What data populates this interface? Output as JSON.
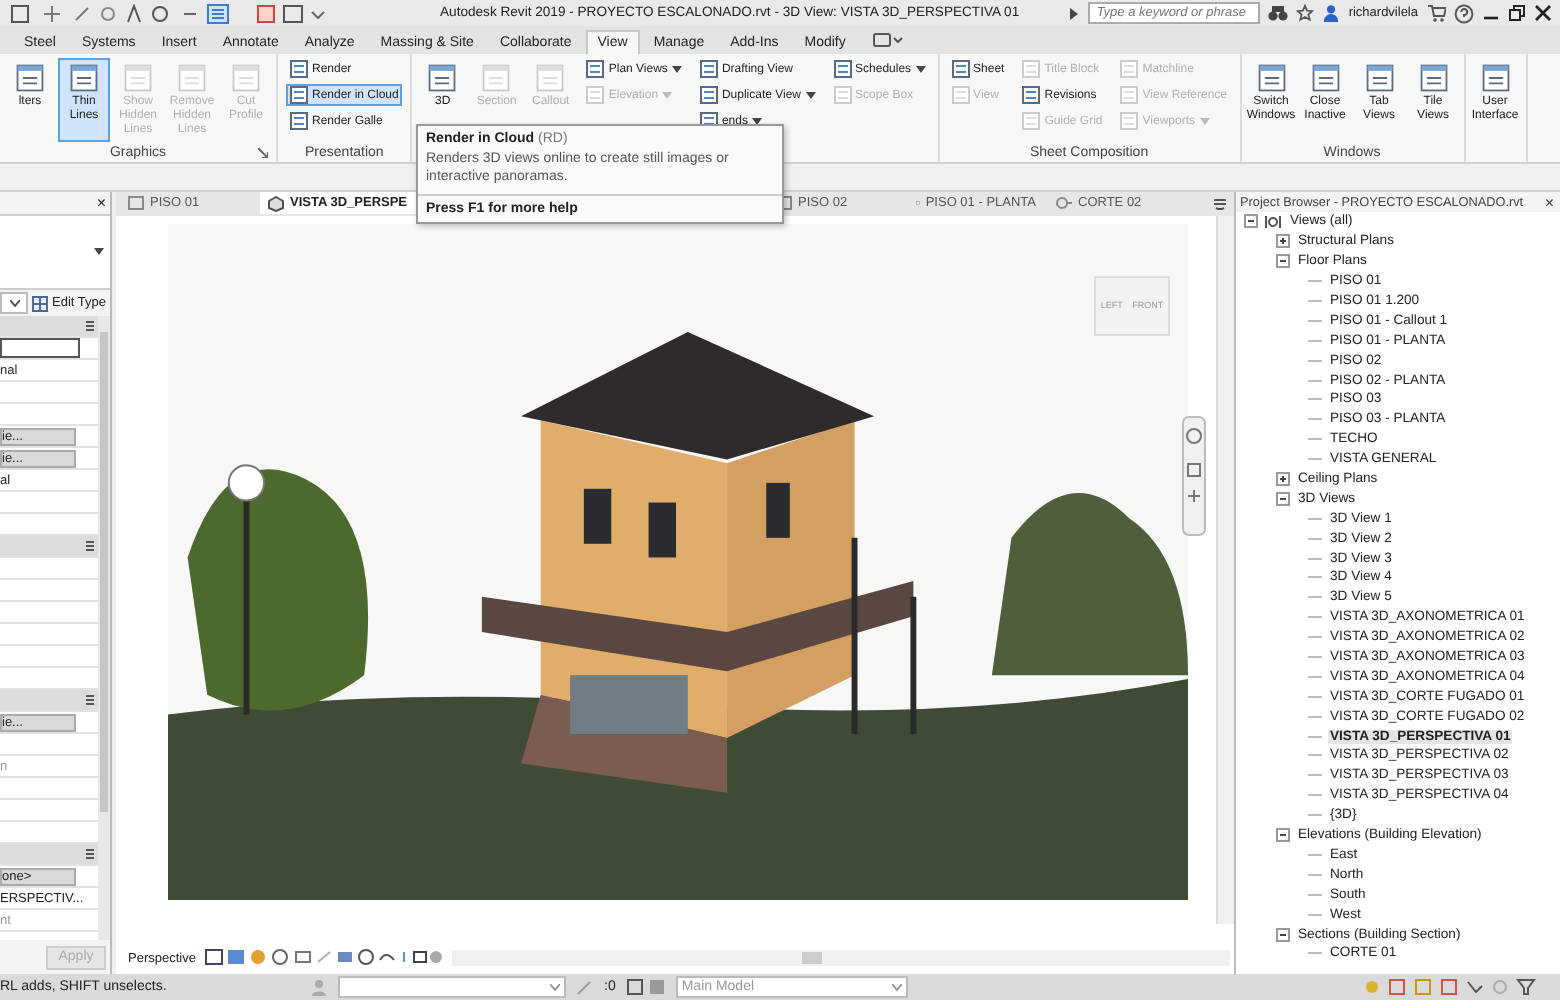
{
  "title_bar": {
    "title": "Autodesk Revit 2019 - PROYECTO ESCALONADO.rvt - 3D View: VISTA 3D_PERSPECTIVA 01",
    "search": {
      "placeholder": "Type a keyword or phrase"
    },
    "user": "richardvilela"
  },
  "ribbon_tabs": [
    {
      "label": "Steel",
      "selected": false
    },
    {
      "label": "Systems",
      "selected": false
    },
    {
      "label": "Insert",
      "selected": false
    },
    {
      "label": "Annotate",
      "selected": false
    },
    {
      "label": "Analyze",
      "selected": false
    },
    {
      "label": "Massing & Site",
      "selected": false
    },
    {
      "label": "Collaborate",
      "selected": false
    },
    {
      "label": "View",
      "selected": true
    },
    {
      "label": "Manage",
      "selected": false
    },
    {
      "label": "Add-Ins",
      "selected": false
    },
    {
      "label": "Modify",
      "selected": false
    }
  ],
  "ribbon_panels": [
    {
      "title": "Graphics",
      "dialog_launcher": true,
      "columns": [
        {
          "kind": "large",
          "items": [
            {
              "label": "lters",
              "disabled": false,
              "selected": false
            }
          ]
        },
        {
          "kind": "large",
          "items": [
            {
              "label": "Thin Lines",
              "disabled": false,
              "selected": true
            }
          ]
        },
        {
          "kind": "large",
          "items": [
            {
              "label": "Show Hidden Lines",
              "disabled": true,
              "selected": false
            }
          ]
        },
        {
          "kind": "large",
          "items": [
            {
              "label": "Remove Hidden Lines",
              "disabled": true,
              "selected": false
            }
          ]
        },
        {
          "kind": "large",
          "items": [
            {
              "label": "Cut Profile",
              "disabled": true,
              "selected": false
            }
          ]
        }
      ]
    },
    {
      "title": "Presentation",
      "columns": [
        {
          "kind": "stack",
          "items": [
            {
              "label": "Render",
              "disabled": false,
              "selected": false,
              "dropdown": false
            },
            {
              "label": "Render  in Cloud",
              "disabled": false,
              "selected": true,
              "dropdown": false
            },
            {
              "label": "Render  Galle",
              "disabled": false,
              "selected": false,
              "dropdown": false
            }
          ]
        }
      ]
    },
    {
      "columns": [
        {
          "kind": "large",
          "items": [
            {
              "label": "3D",
              "disabled": false,
              "selected": false
            }
          ]
        },
        {
          "kind": "large",
          "items": [
            {
              "label": "Section",
              "disabled": true,
              "selected": false
            }
          ]
        },
        {
          "kind": "large",
          "items": [
            {
              "label": "Callout",
              "disabled": true,
              "selected": false
            }
          ]
        },
        {
          "kind": "stack",
          "items": [
            {
              "label": "Plan Views",
              "disabled": false,
              "selected": false,
              "dropdown": true
            },
            {
              "label": "Elevation",
              "disabled": true,
              "selected": false,
              "dropdown": true
            }
          ]
        },
        {
          "kind": "stack",
          "items": [
            {
              "label": "Drafting View",
              "disabled": false,
              "selected": false,
              "dropdown": false
            },
            {
              "label": "Duplicate View",
              "disabled": false,
              "selected": false,
              "dropdown": true
            },
            {
              "label": "ends",
              "disabled": false,
              "selected": false,
              "dropdown": true
            }
          ]
        },
        {
          "kind": "stack",
          "items": [
            {
              "label": "Schedules",
              "disabled": false,
              "selected": false,
              "dropdown": true
            },
            {
              "label": "Scope Box",
              "disabled": true,
              "selected": false,
              "dropdown": false
            }
          ]
        }
      ]
    },
    {
      "title": "Sheet Composition",
      "columns": [
        {
          "kind": "stack",
          "items": [
            {
              "label": "Sheet",
              "disabled": false,
              "selected": false,
              "dropdown": false
            },
            {
              "label": "View",
              "disabled": true,
              "selected": false,
              "dropdown": false
            }
          ]
        },
        {
          "kind": "stack",
          "items": [
            {
              "label": "Title Block",
              "disabled": true,
              "selected": false,
              "dropdown": false
            },
            {
              "label": "Revisions",
              "disabled": false,
              "selected": false,
              "dropdown": false
            },
            {
              "label": "Guide Grid",
              "disabled": true,
              "selected": false,
              "dropdown": false
            }
          ]
        },
        {
          "kind": "stack",
          "items": [
            {
              "label": "Matchline",
              "disabled": true,
              "selected": false,
              "dropdown": false
            },
            {
              "label": "View Reference",
              "disabled": true,
              "selected": false,
              "dropdown": false
            },
            {
              "label": "Viewports",
              "disabled": true,
              "selected": false,
              "dropdown": true
            }
          ]
        }
      ]
    },
    {
      "title": "Windows",
      "columns": [
        {
          "kind": "large",
          "items": [
            {
              "label": "Switch Windows",
              "disabled": false,
              "selected": false
            }
          ]
        },
        {
          "kind": "large",
          "items": [
            {
              "label": "Close Inactive",
              "disabled": false,
              "selected": false
            }
          ]
        },
        {
          "kind": "large",
          "items": [
            {
              "label": "Tab Views",
              "disabled": false,
              "selected": false
            }
          ]
        },
        {
          "kind": "large",
          "items": [
            {
              "label": "Tile Views",
              "disabled": false,
              "selected": false
            }
          ]
        }
      ]
    },
    {
      "columns": [
        {
          "kind": "large",
          "items": [
            {
              "label": "User Interface",
              "disabled": false,
              "selected": false
            }
          ]
        }
      ]
    }
  ],
  "tooltip": {
    "title": "Render in Cloud",
    "shortcut": "(RD)",
    "description": "Renders 3D views online to create still images or interactive panoramas.",
    "help": "Press F1 for more help"
  },
  "properties": {
    "close": "×",
    "edit_type": "Edit Type",
    "rows": [
      {
        "kind": "header"
      },
      {
        "kind": "input"
      },
      {
        "kind": "text",
        "text": "nal"
      },
      {
        "kind": "blank"
      },
      {
        "kind": "blank"
      },
      {
        "kind": "button",
        "text": "ie..."
      },
      {
        "kind": "button",
        "text": "ie..."
      },
      {
        "kind": "text",
        "text": "al"
      },
      {
        "kind": "blank"
      },
      {
        "kind": "blank"
      },
      {
        "kind": "header"
      },
      {
        "kind": "blank"
      },
      {
        "kind": "blank"
      },
      {
        "kind": "blank"
      },
      {
        "kind": "blank"
      },
      {
        "kind": "blank"
      },
      {
        "kind": "blank"
      },
      {
        "kind": "header"
      },
      {
        "kind": "button",
        "text": "ie..."
      },
      {
        "kind": "blank"
      },
      {
        "kind": "grey",
        "text": "n"
      },
      {
        "kind": "blank"
      },
      {
        "kind": "blank"
      },
      {
        "kind": "blank"
      },
      {
        "kind": "header"
      },
      {
        "kind": "button",
        "text": "one>"
      },
      {
        "kind": "text",
        "text": "ERSPECTIV..."
      },
      {
        "kind": "grey",
        "text": "nt"
      },
      {
        "kind": "blank"
      },
      {
        "kind": "blank"
      },
      {
        "kind": "blank"
      }
    ],
    "apply": {
      "label": "Apply",
      "disabled": true
    }
  },
  "view_tabs": [
    {
      "label": "PISO 01",
      "selected": false,
      "kind": "plan"
    },
    {
      "label": "VISTA 3D_PERSPE",
      "selected": true,
      "kind": "perspective"
    },
    {
      "label": "PISO 02",
      "selected": false,
      "kind": "plan"
    },
    {
      "label": "PISO 01 - PLANTA",
      "selected": false,
      "kind": "plan"
    },
    {
      "label": "CORTE 02",
      "selected": false,
      "kind": "section"
    }
  ],
  "viewport": {
    "kind": "picture",
    "view_cube": {
      "left": "LEFT",
      "front": "FRONT"
    }
  },
  "view_bar": {
    "mode": "Perspective"
  },
  "project_browser": {
    "title": "Project Browser - PROYECTO ESCALONADO.rvt",
    "close": "×",
    "tree": [
      {
        "label": "Views (all)",
        "expanded": true,
        "selected": false,
        "children": [
          {
            "label": "Structural Plans",
            "expanded": false,
            "selected": false
          },
          {
            "label": "Floor Plans",
            "expanded": true,
            "selected": false,
            "children": [
              {
                "label": "PISO 01",
                "selected": false
              },
              {
                "label": "PISO 01 1.200",
                "selected": false
              },
              {
                "label": "PISO 01 - Callout 1",
                "selected": false
              },
              {
                "label": "PISO 01 - PLANTA",
                "selected": false
              },
              {
                "label": "PISO 02",
                "selected": false
              },
              {
                "label": "PISO 02 - PLANTA",
                "selected": false
              },
              {
                "label": "PISO 03",
                "selected": false
              },
              {
                "label": "PISO 03 - PLANTA",
                "selected": false
              },
              {
                "label": "TECHO",
                "selected": false
              },
              {
                "label": "VISTA GENERAL",
                "selected": false
              }
            ]
          },
          {
            "label": "Ceiling Plans",
            "expanded": false,
            "selected": false
          },
          {
            "label": "3D Views",
            "expanded": true,
            "selected": false,
            "children": [
              {
                "label": "3D View 1",
                "selected": false
              },
              {
                "label": "3D View 2",
                "selected": false
              },
              {
                "label": "3D View 3",
                "selected": false
              },
              {
                "label": "3D View 4",
                "selected": false
              },
              {
                "label": "3D View 5",
                "selected": false
              },
              {
                "label": "VISTA 3D_AXONOMETRICA 01",
                "selected": false
              },
              {
                "label": "VISTA 3D_AXONOMETRICA 02",
                "selected": false
              },
              {
                "label": "VISTA 3D_AXONOMETRICA 03",
                "selected": false
              },
              {
                "label": "VISTA 3D_AXONOMETRICA 04",
                "selected": false
              },
              {
                "label": "VISTA 3D_CORTE FUGADO 01",
                "selected": false
              },
              {
                "label": "VISTA 3D_CORTE FUGADO 02",
                "selected": false
              },
              {
                "label": "VISTA 3D_PERSPECTIVA 01",
                "selected": true
              },
              {
                "label": "VISTA 3D_PERSPECTIVA 02",
                "selected": false
              },
              {
                "label": "VISTA 3D_PERSPECTIVA 03",
                "selected": false
              },
              {
                "label": "VISTA 3D_PERSPECTIVA 04",
                "selected": false
              },
              {
                "label": "{3D}",
                "selected": false
              }
            ]
          },
          {
            "label": "Elevations (Building Elevation)",
            "expanded": true,
            "selected": false,
            "children": [
              {
                "label": "East",
                "selected": false
              },
              {
                "label": "North",
                "selected": false
              },
              {
                "label": "South",
                "selected": false
              },
              {
                "label": "West",
                "selected": false
              }
            ]
          },
          {
            "label": "Sections (Building Section)",
            "expanded": true,
            "selected": false,
            "children": [
              {
                "label": "CORTE 01",
                "selected": false
              }
            ]
          }
        ]
      }
    ]
  },
  "status_bar": {
    "message": "RL adds, SHIFT unselects.",
    "filter_count": ":0",
    "model": "Main Model"
  }
}
